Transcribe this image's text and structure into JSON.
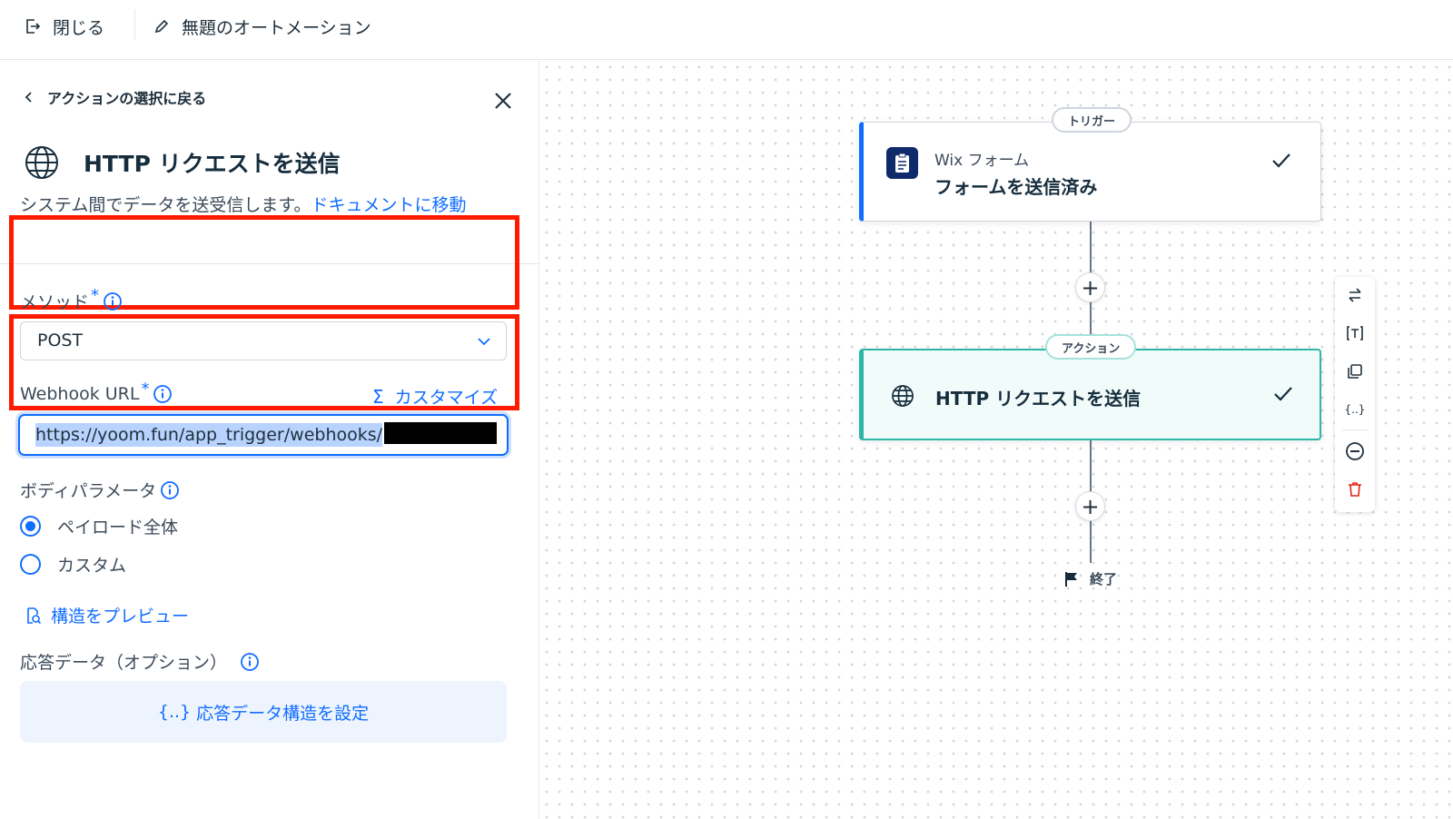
{
  "topbar": {
    "close_label": "閉じる",
    "title": "無題のオートメーション"
  },
  "panel": {
    "back_label": "アクションの選択に戻る",
    "title": "HTTP リクエストを送信",
    "description": "システム間でデータを送受信します。",
    "doc_link": "ドキュメントに移動",
    "method": {
      "label": "メソッド",
      "required": "*",
      "value": "POST"
    },
    "webhook": {
      "label": "Webhook URL",
      "required": "*",
      "customize": "カスタマイズ",
      "value": "https://yoom.fun/app_trigger/webhooks/"
    },
    "body_param": {
      "label": "ボディパラメータ",
      "options": [
        "ペイロード全体",
        "カスタム"
      ],
      "selected": "ペイロード全体"
    },
    "preview_link": "構造をプレビュー",
    "response": {
      "label": "応答データ（オプション）",
      "button_icon": "{..}",
      "button_label": "応答データ構造を設定"
    }
  },
  "canvas": {
    "trigger": {
      "pill": "トリガー",
      "app": "Wix フォーム",
      "title": "フォームを送信済み"
    },
    "action": {
      "pill": "アクション",
      "title": "HTTP リクエストを送信"
    },
    "end_label": "終了",
    "toolbar_icons": [
      "swap-icon",
      "text-icon",
      "duplicate-icon",
      "variables-icon",
      "disable-icon",
      "delete-icon"
    ]
  },
  "colors": {
    "accent": "#116dff",
    "highlight_box": "#ff1a00",
    "action_border": "#2db6a6",
    "delete": "#e62214"
  }
}
